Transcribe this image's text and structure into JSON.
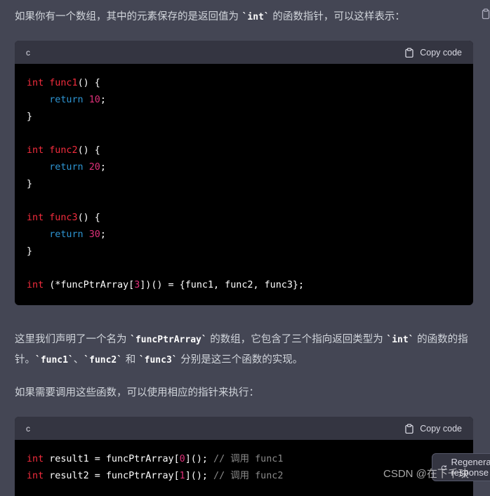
{
  "intro": {
    "before": "如果你有一个数组，其中的元素保存的是返回值为 ",
    "code": "`int`",
    "after": " 的函数指针，可以这样表示："
  },
  "block1": {
    "lang": "c",
    "copy_label": "Copy code",
    "lines": [
      [
        {
          "t": "int",
          "c": "kw"
        },
        {
          "t": " "
        },
        {
          "t": "func1",
          "c": "fn"
        },
        {
          "t": "() {"
        }
      ],
      [
        {
          "t": "    "
        },
        {
          "t": "return",
          "c": "ret"
        },
        {
          "t": " "
        },
        {
          "t": "10",
          "c": "num"
        },
        {
          "t": ";"
        }
      ],
      [
        {
          "t": "}"
        }
      ],
      [],
      [
        {
          "t": "int",
          "c": "kw"
        },
        {
          "t": " "
        },
        {
          "t": "func2",
          "c": "fn"
        },
        {
          "t": "() {"
        }
      ],
      [
        {
          "t": "    "
        },
        {
          "t": "return",
          "c": "ret"
        },
        {
          "t": " "
        },
        {
          "t": "20",
          "c": "num"
        },
        {
          "t": ";"
        }
      ],
      [
        {
          "t": "}"
        }
      ],
      [],
      [
        {
          "t": "int",
          "c": "kw"
        },
        {
          "t": " "
        },
        {
          "t": "func3",
          "c": "fn"
        },
        {
          "t": "() {"
        }
      ],
      [
        {
          "t": "    "
        },
        {
          "t": "return",
          "c": "ret"
        },
        {
          "t": " "
        },
        {
          "t": "30",
          "c": "num"
        },
        {
          "t": ";"
        }
      ],
      [
        {
          "t": "}"
        }
      ],
      [],
      [
        {
          "t": "int",
          "c": "kw"
        },
        {
          "t": " (*funcPtrArray["
        },
        {
          "t": "3",
          "c": "num"
        },
        {
          "t": "])() = {func1, func2, func3};"
        }
      ]
    ]
  },
  "para2": {
    "p1": "这里我们声明了一个名为 ",
    "c1": "`funcPtrArray`",
    "p2": " 的数组，它包含了三个指向返回类型为 ",
    "c2": "`int`",
    "p3": " 的函数的指针。",
    "c3": "`func1`",
    "p4": "、",
    "c4": "`func2`",
    "p5": " 和 ",
    "c5": "`func3`",
    "p6": " 分别是这三个函数的实现。"
  },
  "para3": "如果需要调用这些函数，可以使用相应的指针来执行：",
  "block2": {
    "lang": "c",
    "copy_label": "Copy code",
    "lines": [
      [
        {
          "t": "int",
          "c": "kw"
        },
        {
          "t": " result1 = funcPtrArray["
        },
        {
          "t": "0",
          "c": "num"
        },
        {
          "t": "](); "
        },
        {
          "t": "// 调用 func1",
          "c": "cm"
        }
      ],
      [
        {
          "t": "int",
          "c": "kw"
        },
        {
          "t": " result2 = funcPtrArray["
        },
        {
          "t": "1",
          "c": "num"
        },
        {
          "t": "](); "
        },
        {
          "t": "// 调用 func2",
          "c": "cm"
        }
      ]
    ]
  },
  "watermark": "CSDN @在下千玦",
  "regen_label": "Regenerate response",
  "icons": {
    "copy": "clipboard-icon",
    "regen": "refresh-icon",
    "copy_message": "copy-icon"
  }
}
